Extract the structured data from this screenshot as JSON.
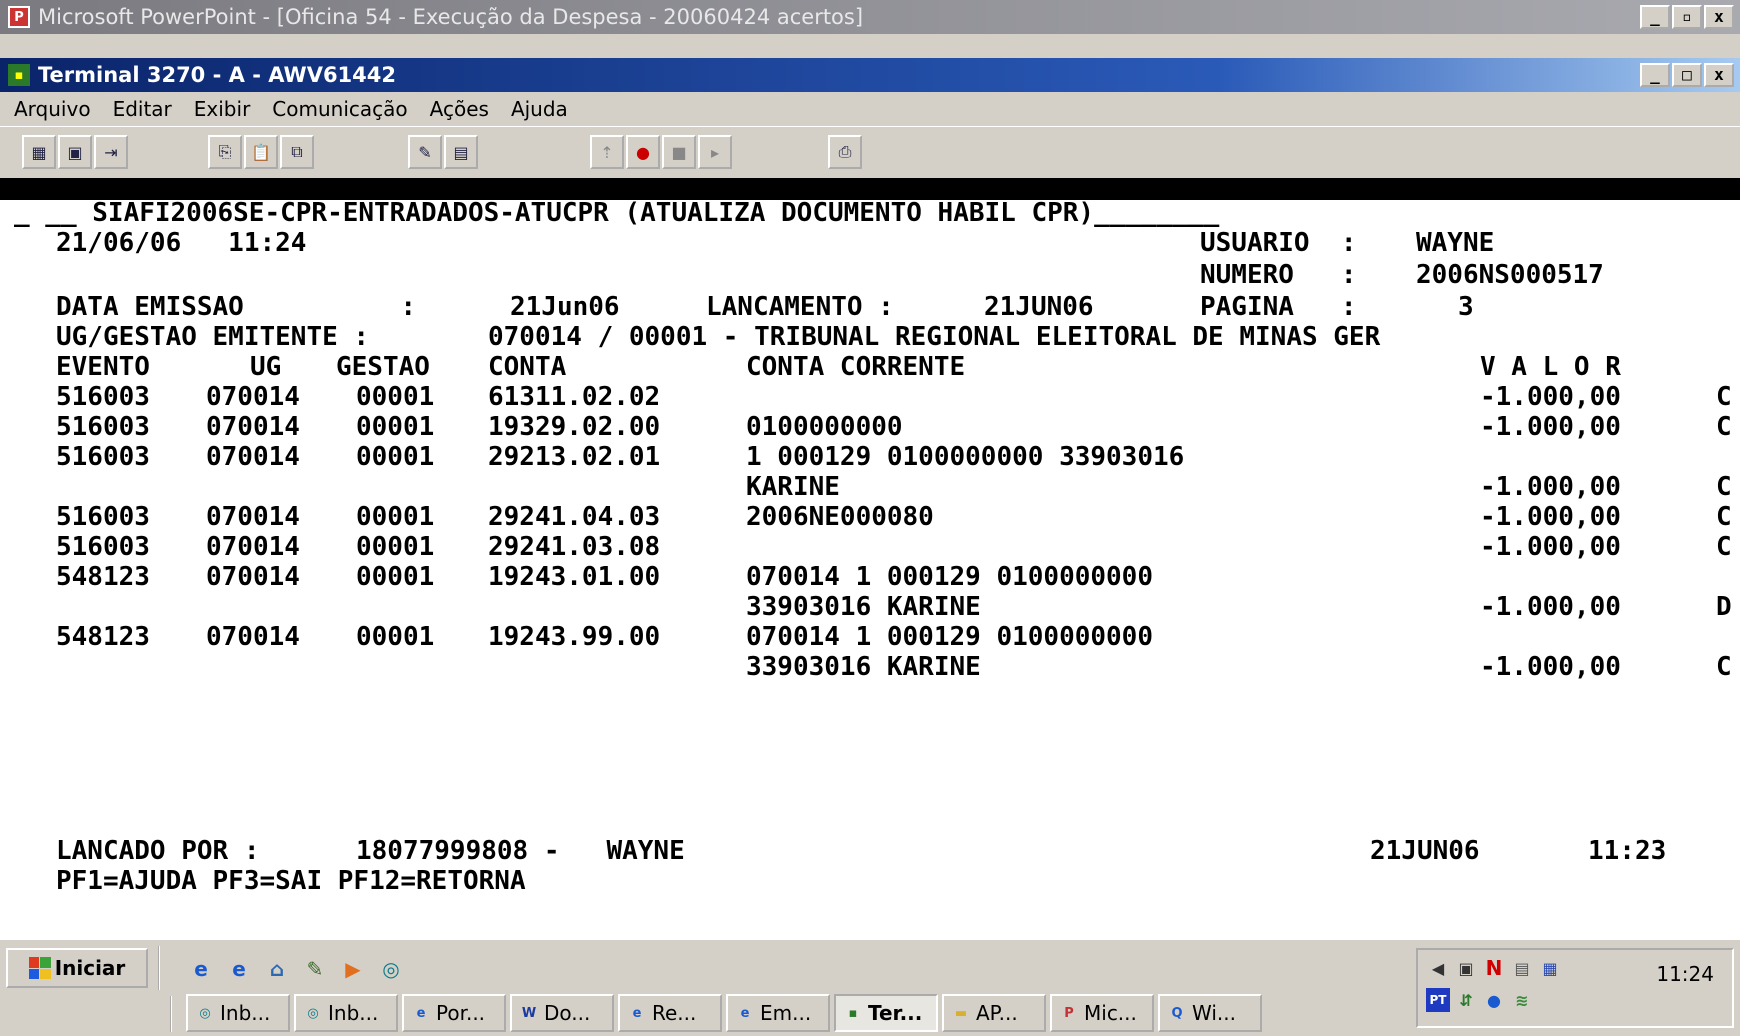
{
  "outer_window": {
    "title": "Microsoft PowerPoint - [Oficina 54 - Execução da Despesa - 20060424 acertos]"
  },
  "terminal_window": {
    "title": "Terminal 3270 - A - AWV61442"
  },
  "menu": [
    "Arquivo",
    "Editar",
    "Exibir",
    "Comunicação",
    "Ações",
    "Ajuda"
  ],
  "window_buttons": {
    "minimize": "_",
    "restore": "▫",
    "maximize": "□",
    "close": "x"
  },
  "screen": {
    "header": "_ __ SIAFI2006SE-CPR-ENTRADADOS-ATUCPR (ATUALIZA DOCUMENTO HABIL CPR)________",
    "datetime": "21/06/06   11:24",
    "usuario_label": "USUARIO  :",
    "usuario": "WAYNE",
    "numero_label": "NUMERO   :",
    "numero": "2006NS000517",
    "data_emissao_label": "DATA EMISSAO          :",
    "data_emissao": "21Jun06",
    "lancamento_label": "LANCAMENTO :",
    "lancamento": "21JUN06",
    "pagina_label": "PAGINA   :",
    "pagina": "3",
    "ug_emitente_label": "UG/GESTAO EMITENTE :",
    "ug_emitente": "070014 / 00001 - TRIBUNAL REGIONAL ELEITORAL DE MINAS GER",
    "columns": {
      "evento": "EVENTO",
      "ug": "UG",
      "gestao": "GESTAO",
      "conta": "CONTA",
      "conta_corrente": "CONTA CORRENTE",
      "valor": "V A L O R"
    },
    "rows": [
      {
        "evento": "516003",
        "ug": "070014",
        "gestao": "00001",
        "conta": "61311.02.02",
        "cc1": "",
        "cc2": "",
        "valor": "-1.000,00",
        "dc": "C"
      },
      {
        "evento": "516003",
        "ug": "070014",
        "gestao": "00001",
        "conta": "19329.02.00",
        "cc1": "0100000000",
        "cc2": "",
        "valor": "-1.000,00",
        "dc": "C"
      },
      {
        "evento": "516003",
        "ug": "070014",
        "gestao": "00001",
        "conta": "29213.02.01",
        "cc1": "1 000129 0100000000 33903016",
        "cc2": "KARINE",
        "valor": "-1.000,00",
        "dc": "C"
      },
      {
        "evento": "516003",
        "ug": "070014",
        "gestao": "00001",
        "conta": "29241.04.03",
        "cc1": "2006NE000080",
        "cc2": "",
        "valor": "-1.000,00",
        "dc": "C"
      },
      {
        "evento": "516003",
        "ug": "070014",
        "gestao": "00001",
        "conta": "29241.03.08",
        "cc1": "",
        "cc2": "",
        "valor": "-1.000,00",
        "dc": "C"
      },
      {
        "evento": "548123",
        "ug": "070014",
        "gestao": "00001",
        "conta": "19243.01.00",
        "cc1": "070014 1 000129 0100000000",
        "cc2": "33903016 KARINE",
        "valor": "-1.000,00",
        "dc": "D"
      },
      {
        "evento": "548123",
        "ug": "070014",
        "gestao": "00001",
        "conta": "19243.99.00",
        "cc1": "070014 1 000129 0100000000",
        "cc2": "33903016 KARINE",
        "valor": "-1.000,00",
        "dc": "C"
      }
    ],
    "lancado_por_label": "LANCADO POR :",
    "lancado_por": "18077999808 -   WAYNE",
    "lancado_data": "21JUN06",
    "lancado_hora": "11:23",
    "pf_keys": "PF1=AJUDA PF3=SAI PF12=RETORNA"
  },
  "taskbar": {
    "start_label": "Iniciar",
    "clock": "11:24",
    "tasks": [
      {
        "label": "Inb...",
        "icon": "outlook-icon",
        "color": "#0a7a8a"
      },
      {
        "label": "Inb...",
        "icon": "outlook-icon",
        "color": "#0a7a8a"
      },
      {
        "label": "Por...",
        "icon": "ie-icon",
        "color": "#1a5ad0"
      },
      {
        "label": "Do...",
        "icon": "word-icon",
        "color": "#1a3aa0"
      },
      {
        "label": "Re...",
        "icon": "ie-icon",
        "color": "#1a5ad0"
      },
      {
        "label": "Em...",
        "icon": "ie-icon",
        "color": "#1a5ad0"
      },
      {
        "label": "Ter...",
        "icon": "terminal-icon",
        "color": "#2a7a2a"
      },
      {
        "label": "AP...",
        "icon": "folder-icon",
        "color": "#d8b030"
      },
      {
        "label": "Mic...",
        "icon": "powerpoint-icon",
        "color": "#c33333"
      },
      {
        "label": "Wi...",
        "icon": "search-icon",
        "color": "#1a5ad0"
      }
    ]
  }
}
